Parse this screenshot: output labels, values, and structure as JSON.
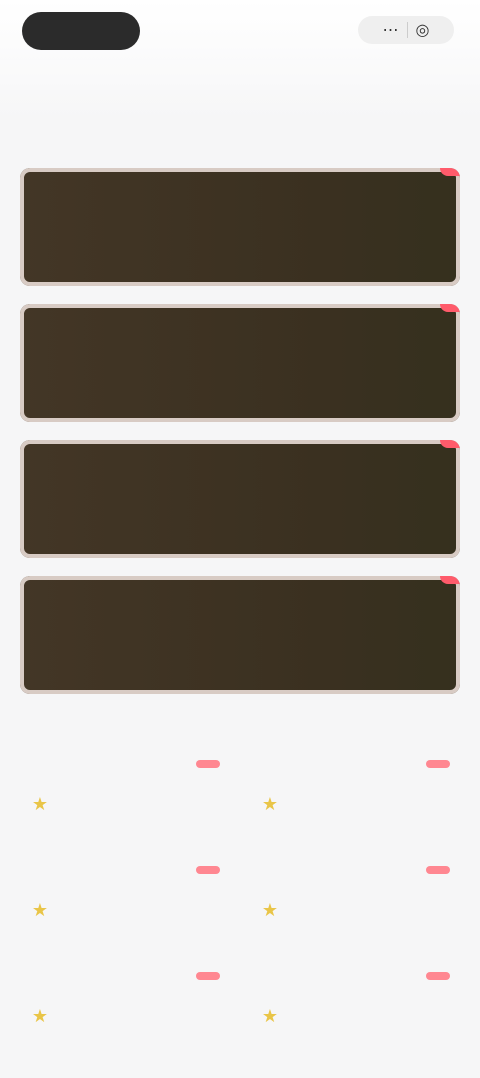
{
  "header": {
    "left_label": "",
    "right_label": "",
    "title": ""
  },
  "sections": {
    "coupons_title": "",
    "grid_title": ""
  },
  "coupons": [
    {
      "badge": "",
      "small": "",
      "amount": "",
      "unit": "",
      "desc": ""
    },
    {
      "badge": "",
      "small": "",
      "amount": "",
      "unit": "",
      "desc": ""
    },
    {
      "badge": "",
      "small": "",
      "amount": "",
      "unit": "",
      "desc": ""
    },
    {
      "badge": "",
      "small": "",
      "amount": "",
      "unit": "",
      "desc": ""
    }
  ],
  "grid": {
    "items": [
      {
        "tag": "",
        "label": "",
        "sub": ""
      },
      {
        "tag": "",
        "label": "",
        "sub": ""
      },
      {
        "tag": "",
        "label": "",
        "sub": ""
      },
      {
        "tag": "",
        "label": "",
        "sub": ""
      },
      {
        "tag": "",
        "label": "",
        "sub": ""
      },
      {
        "tag": "",
        "label": "",
        "sub": ""
      }
    ]
  },
  "colors": {
    "accent_gold": "#f0c65a",
    "badge_red": "#ff5b6b",
    "card_brown": "#3a3020"
  },
  "icons": {
    "star": "star-icon",
    "menu": "menu-icon",
    "close": "close-icon"
  }
}
